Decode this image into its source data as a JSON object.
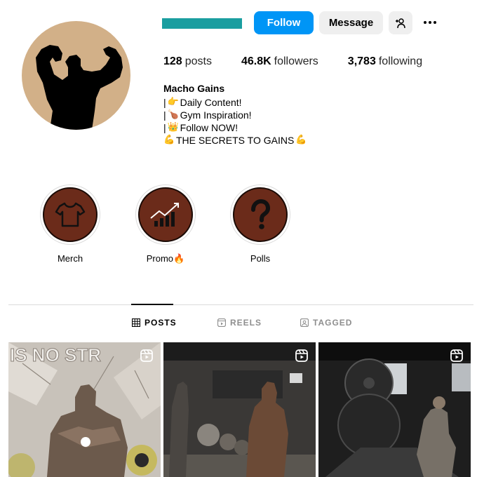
{
  "profile": {
    "username_redacted_color": "#1a9ea0",
    "follow_label": "Follow",
    "message_label": "Message",
    "add_user_icon": "person-plus-icon",
    "more_icon": "more-options-icon"
  },
  "stats": {
    "posts_count": "128",
    "posts_label": "posts",
    "followers_count": "46.8K",
    "followers_label": "followers",
    "following_count": "3,783",
    "following_label": "following"
  },
  "bio": {
    "name": "Macho Gains",
    "line1_emoji": "👉",
    "line1": "Daily Content!",
    "line2_emoji": "🍗",
    "line2": "Gym Inspiration!",
    "line3_emoji": "👑",
    "line3": "Follow NOW!",
    "line4_emoji": "💪",
    "line4": "THE SECRETS TO GAINS"
  },
  "highlights": [
    {
      "label": "Merch",
      "icon": "tshirt-icon"
    },
    {
      "label": "Promo🔥",
      "icon": "chart-up-icon"
    },
    {
      "label": "Polls",
      "icon": "question-mark-icon"
    }
  ],
  "tabs": [
    {
      "label": "POSTS",
      "icon": "grid-icon",
      "active": true
    },
    {
      "label": "REELS",
      "icon": "reels-icon",
      "active": false
    },
    {
      "label": "TAGGED",
      "icon": "tagged-icon",
      "active": false
    }
  ],
  "posts": [
    {
      "overlay_text": "IS NO STR",
      "type": "reel"
    },
    {
      "type": "reel"
    },
    {
      "type": "reel"
    }
  ],
  "colors": {
    "accent": "#0095f6",
    "highlight_fill": "#6b2b1a",
    "avatar_bg": "#d2b088"
  }
}
